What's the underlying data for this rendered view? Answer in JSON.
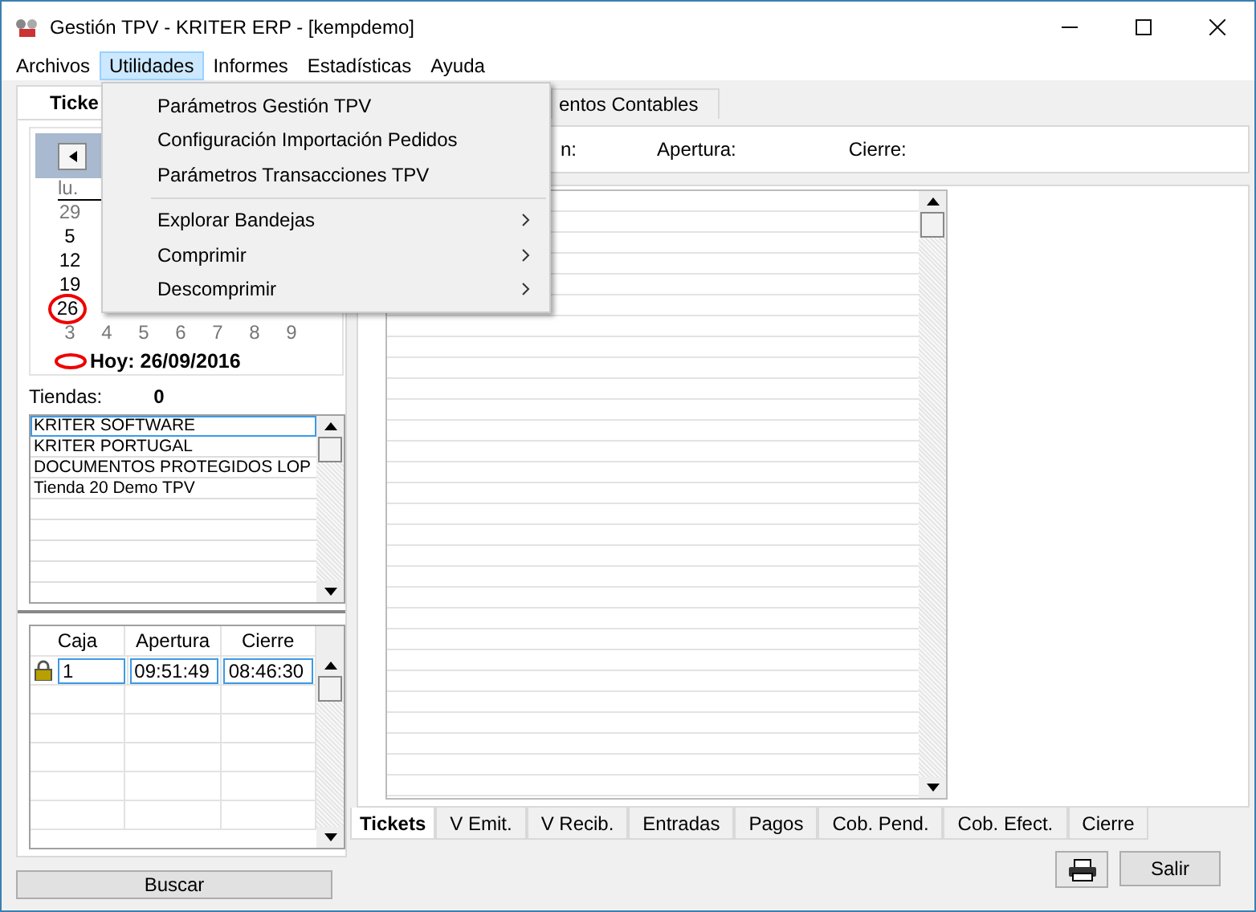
{
  "window": {
    "title": "Gestión TPV - KRITER ERP - [kempdemo]"
  },
  "menu_bar": [
    {
      "label": "Archivos",
      "selected": false
    },
    {
      "label": "Utilidades",
      "selected": true
    },
    {
      "label": "Informes",
      "selected": false
    },
    {
      "label": "Estadísticas",
      "selected": false
    },
    {
      "label": "Ayuda",
      "selected": false
    }
  ],
  "open_menu": {
    "items": [
      {
        "kind": "item",
        "label": "Parámetros Gestión TPV",
        "submenu": false
      },
      {
        "kind": "item",
        "label": "Configuración Importación Pedidos",
        "submenu": false
      },
      {
        "kind": "item",
        "label": "Parámetros Transacciones TPV",
        "submenu": false
      },
      {
        "kind": "separator"
      },
      {
        "kind": "item",
        "label": "Explorar Bandejas",
        "submenu": true
      },
      {
        "kind": "item",
        "label": "Comprimir",
        "submenu": true
      },
      {
        "kind": "item",
        "label": "Descomprimir",
        "submenu": true
      }
    ]
  },
  "left_panel": {
    "tab": {
      "label": "Ticke",
      "selected": true
    },
    "calendar": {
      "weekday_header": "lu.",
      "weeks": [
        [
          {
            "day": "29",
            "muted": true,
            "circled": false
          }
        ],
        [
          {
            "day": "5",
            "muted": false,
            "circled": false
          }
        ],
        [
          {
            "day": "12",
            "muted": false,
            "circled": false
          }
        ],
        [
          {
            "day": "19",
            "muted": false,
            "circled": false
          }
        ],
        [
          {
            "day": "26",
            "muted": false,
            "circled": true
          }
        ],
        [
          {
            "day": "3",
            "muted": true,
            "circled": false
          },
          {
            "day": "4",
            "muted": true,
            "circled": false
          },
          {
            "day": "5",
            "muted": true,
            "circled": false
          },
          {
            "day": "6",
            "muted": true,
            "circled": false
          },
          {
            "day": "7",
            "muted": true,
            "circled": false
          },
          {
            "day": "8",
            "muted": true,
            "circled": false
          },
          {
            "day": "9",
            "muted": true,
            "circled": false
          }
        ]
      ],
      "today_label": "Hoy: 26/09/2016"
    },
    "stores": {
      "label": "Tiendas:",
      "count": "0",
      "items": [
        {
          "name": "KRITER SOFTWARE",
          "selected": true
        },
        {
          "name": "KRITER PORTUGAL",
          "selected": false
        },
        {
          "name": "DOCUMENTOS PROTEGIDOS LOP",
          "selected": false
        },
        {
          "name": "Tienda 20 Demo TPV",
          "selected": false
        }
      ]
    },
    "cash_grid": {
      "columns": [
        "Caja",
        "Apertura",
        "Cierre"
      ],
      "rows": [
        {
          "locked": true,
          "cells": [
            "1",
            "09:51:49",
            "08:46:30"
          ]
        }
      ]
    },
    "search_button": "Buscar"
  },
  "right_panel": {
    "tabs": [
      {
        "label": "entos Contables",
        "selected": false
      }
    ],
    "info_labels": [
      "n:",
      "Apertura:",
      "Cierre:"
    ],
    "bottom_tabs": [
      {
        "label": "Tickets",
        "selected": true
      },
      {
        "label": "V Emit.",
        "selected": false
      },
      {
        "label": "V Recib.",
        "selected": false
      },
      {
        "label": "Entradas",
        "selected": false
      },
      {
        "label": "Pagos",
        "selected": false
      },
      {
        "label": "Cob. Pend.",
        "selected": false
      },
      {
        "label": "Cob. Efect.",
        "selected": false
      },
      {
        "label": "Cierre",
        "selected": false
      }
    ],
    "exit_button": "Salir"
  }
}
